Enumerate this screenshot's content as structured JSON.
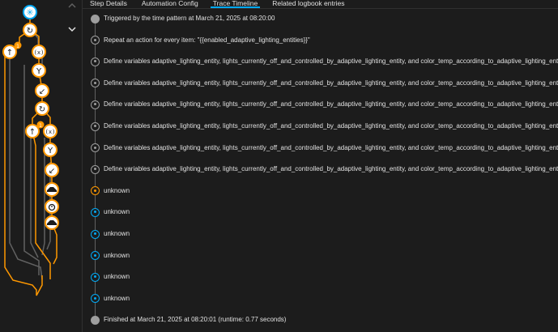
{
  "tabs": [
    {
      "label": "Step Details",
      "active": false
    },
    {
      "label": "Automation Config",
      "active": false
    },
    {
      "label": "Trace Timeline",
      "active": true
    },
    {
      "label": "Related logbook entries",
      "active": false
    }
  ],
  "sidebar": {
    "collapse_icon": "chevron-up-icon",
    "expand_icon": "chevron-down-icon",
    "node_icons": [
      "asterisk-icon",
      "repeat-icon",
      "arrow-up-icon",
      "variable-icon",
      "fork-icon",
      "arrow-down-left-icon",
      "repeat-icon",
      "arrow-up-icon",
      "variable-icon",
      "fork-icon",
      "arrow-down-left-icon",
      "scene-icon",
      "timer-icon",
      "scene-icon"
    ],
    "badges": [
      "1",
      "1"
    ]
  },
  "timeline": [
    {
      "text": "Triggered by the time pattern at March 21, 2025 at 08:20:00",
      "dot": "solid"
    },
    {
      "text": "Repeat an action for every item: \"{{enabled_adaptive_lighting_entities}}\"",
      "dot": "ring"
    },
    {
      "text": "Define variables adaptive_lighting_entity, lights_currently_off_and_controlled_by_adaptive_lighting_entity, and color_temp_according_to_adaptive_lighting_entity",
      "dot": "ring"
    },
    {
      "text": "Define variables adaptive_lighting_entity, lights_currently_off_and_controlled_by_adaptive_lighting_entity, and color_temp_according_to_adaptive_lighting_entity",
      "dot": "ring"
    },
    {
      "text": "Define variables adaptive_lighting_entity, lights_currently_off_and_controlled_by_adaptive_lighting_entity, and color_temp_according_to_adaptive_lighting_entity",
      "dot": "ring"
    },
    {
      "text": "Define variables adaptive_lighting_entity, lights_currently_off_and_controlled_by_adaptive_lighting_entity, and color_temp_according_to_adaptive_lighting_entity",
      "dot": "ring"
    },
    {
      "text": "Define variables adaptive_lighting_entity, lights_currently_off_and_controlled_by_adaptive_lighting_entity, and color_temp_according_to_adaptive_lighting_entity",
      "dot": "ring"
    },
    {
      "text": "Define variables adaptive_lighting_entity, lights_currently_off_and_controlled_by_adaptive_lighting_entity, and color_temp_according_to_adaptive_lighting_entity",
      "dot": "ring"
    },
    {
      "text": "unknown",
      "dot": "orange"
    },
    {
      "text": "unknown",
      "dot": "blue"
    },
    {
      "text": "unknown",
      "dot": "blue"
    },
    {
      "text": "unknown",
      "dot": "blue"
    },
    {
      "text": "unknown",
      "dot": "blue"
    },
    {
      "text": "unknown",
      "dot": "blue"
    },
    {
      "text": "Finished at March 21, 2025 at 08:20:01 (runtime: 0.77 seconds)",
      "dot": "solid"
    }
  ],
  "colors": {
    "active_path": "#ff9800",
    "trigger": "#03a9f4",
    "inactive_path": "#616161",
    "node_fill": "#ffffff"
  }
}
